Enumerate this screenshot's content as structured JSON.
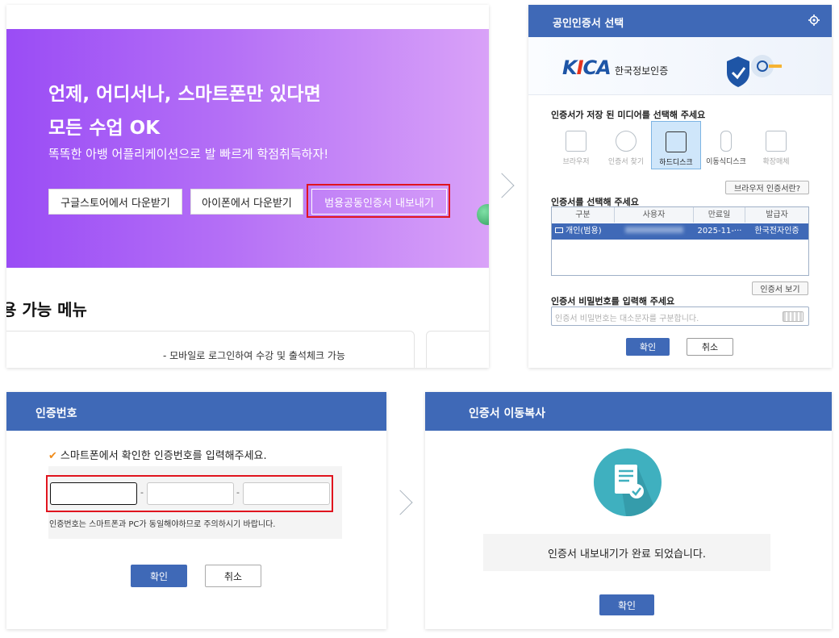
{
  "panel_app": {
    "headline_line1": "언제, 어디서나, 스마트폰만 있다면",
    "headline_line2": "모든 수업 OK",
    "subtitle": "똑똑한 아뱅 어플리케이션으로 발 빠르게 학점취득하자!",
    "buttons": [
      "구글스토어에서 다운받기",
      "아이폰에서 다운받기",
      "범용공동인증서 내보내기"
    ],
    "menu_title": "용 가능 메뉴",
    "card_text": "- 모바일로 로그인하여 수강 및 출석체크 가능"
  },
  "panel_cert": {
    "title": "공인인증서 선택",
    "logo_text": "한국정보인증",
    "logo_mark": "KICA",
    "media_label": "인증서가 저장 된 미디어를 선택해 주세요",
    "media": [
      "브라우저",
      "인증서 찾기",
      "하드디스크",
      "이동식디스크",
      "확장매체"
    ],
    "browser_cert_button": "브라우저 인증서란?",
    "select_label": "인증서를 선택해 주세요",
    "columns": [
      "구분",
      "사용자",
      "만료일",
      "발급자"
    ],
    "row": {
      "type": "개인(범용)",
      "expiry": "2025-11-···",
      "issuer": "한국전자인증"
    },
    "view_button": "인증서 보기",
    "password_label": "인증서 비밀번호를 입력해 주세요",
    "password_placeholder": "인증서 비밀번호는 대소문자를 구분합니다.",
    "ok": "확인",
    "cancel": "취소"
  },
  "panel_code": {
    "title": "인증번호",
    "message": "스마트폰에서 확인한 인증번호를 입력해주세요.",
    "separator": "-",
    "note": "인증번호는 스마트폰과 PC가 동일해야하므로 주의하시기 바랍니다.",
    "ok": "확인",
    "cancel": "취소"
  },
  "panel_done": {
    "title": "인증서 이동복사",
    "message": "인증서 내보내기가 완료 되었습니다.",
    "ok": "확인"
  },
  "colors": {
    "header": "#3f69b7",
    "highlight": "#e0141e",
    "banner_start": "#9a4cf5",
    "banner_end": "#d9a2f8",
    "check": "#f08c1c"
  }
}
